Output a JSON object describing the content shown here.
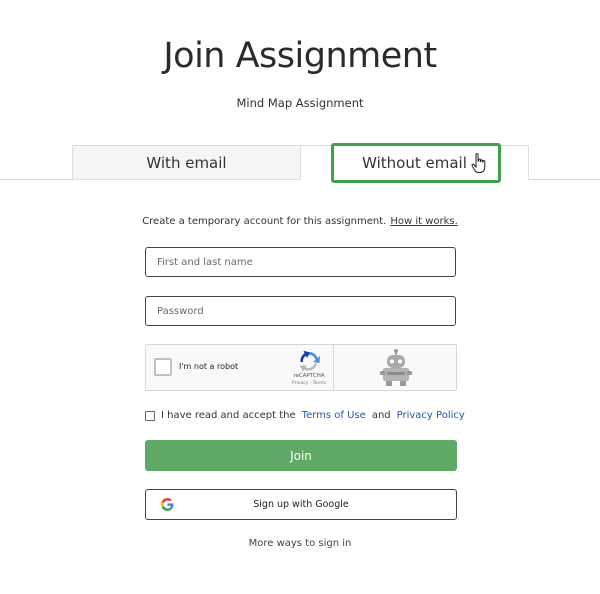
{
  "page": {
    "title": "Join Assignment",
    "subtitle": "Mind Map Assignment"
  },
  "tabs": {
    "with_email": "With email",
    "without_email": "Without email",
    "active": "without_email",
    "highlight_color": "#3ea24f"
  },
  "form": {
    "intro_text": "Create a temporary account for this assignment.",
    "how_link": "How it works.",
    "name_placeholder": "First and last name",
    "password_placeholder": "Password",
    "captcha": {
      "label": "I'm not a robot",
      "brand": "reCAPTCHA",
      "links": "Privacy - Terms"
    },
    "terms": {
      "prefix": "I have read and accept the",
      "terms_link": "Terms of Use",
      "and": "and",
      "privacy_link": "Privacy Policy"
    },
    "join_label": "Join",
    "join_color": "#5ea966",
    "google_label": "Sign up with Google",
    "more_label": "More ways to sign in"
  },
  "icons": [
    "pointer-hand-icon",
    "recaptcha-logo-icon",
    "robot-icon",
    "google-icon",
    "checkbox-icon"
  ]
}
